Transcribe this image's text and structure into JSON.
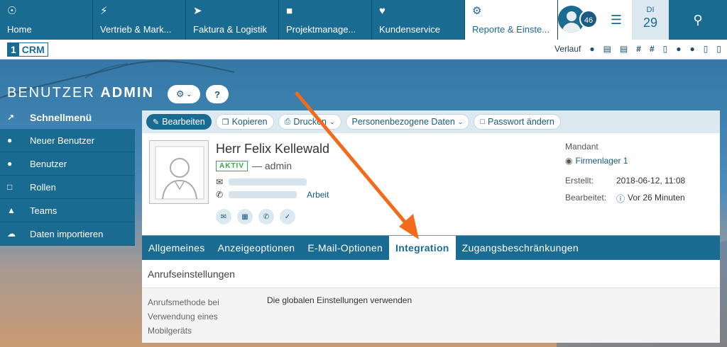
{
  "nav": {
    "tabs": [
      {
        "label": "Home",
        "icon": "globe-icon"
      },
      {
        "label": "Vertrieb & Mark...",
        "icon": "bolt-icon"
      },
      {
        "label": "Faktura & Logistik",
        "icon": "paper-plane-icon"
      },
      {
        "label": "Projektmanage...",
        "icon": "box-icon"
      },
      {
        "label": "Kundenservice",
        "icon": "heart-icon"
      },
      {
        "label": "Reporte & Einste...",
        "icon": "gear-icon"
      }
    ],
    "notification_count": "46",
    "date_dow": "DI",
    "date_day": "29"
  },
  "subbar": {
    "logo_num": "1",
    "logo_text": "CRM",
    "history_label": "Verlauf"
  },
  "page": {
    "title_light": "BENUTZER",
    "title_bold": "ADMIN"
  },
  "sidebar": {
    "heading": "Schnellmenü",
    "items": [
      {
        "label": "Neuer Benutzer",
        "icon": "user-icon"
      },
      {
        "label": "Benutzer",
        "icon": "user-icon"
      },
      {
        "label": "Rollen",
        "icon": "lock-icon"
      },
      {
        "label": "Teams",
        "icon": "tshirt-icon"
      },
      {
        "label": "Daten importieren",
        "icon": "cloud-upload-icon"
      }
    ]
  },
  "toolbar": {
    "edit": "Bearbeiten",
    "copy": "Kopieren",
    "print": "Drucken",
    "personal_data": "Personenbezogene Daten",
    "password": "Passwort ändern"
  },
  "record": {
    "name": "Herr Felix Kellewald",
    "status": "AKTIV",
    "username": "— admin",
    "phone_label": "Arbeit",
    "mandant_label": "Mandant",
    "mandant_value": "Firmenlager 1",
    "created_label": "Erstellt:",
    "created_value": "2018-06-12, 11:08",
    "modified_label": "Bearbeitet:",
    "modified_value": "Vor 26 Minuten"
  },
  "tabs": [
    {
      "label": "Allgemeines"
    },
    {
      "label": "Anzeigeoptionen"
    },
    {
      "label": "E-Mail-Optionen"
    },
    {
      "label": "Integration"
    },
    {
      "label": "Zugangsbeschränkungen"
    }
  ],
  "section": {
    "title": "Anrufseinstellungen",
    "field_label": "Anrufsmethode bei Verwendung eines Mobilgeräts",
    "field_value": "Die globalen Einstellungen verwenden"
  },
  "colors": {
    "primary": "#1a6b91",
    "active_status": "#3aa84a",
    "arrow": "#f26b1d"
  }
}
